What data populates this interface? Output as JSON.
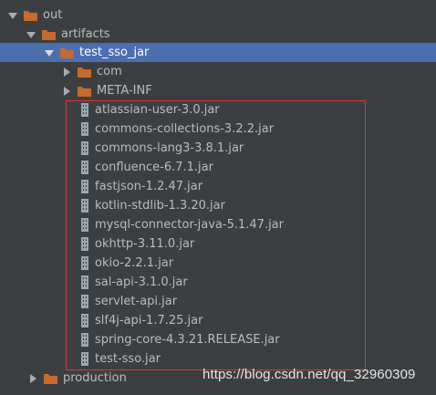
{
  "tree": {
    "out": {
      "label": "out"
    },
    "artifacts": {
      "label": "artifacts"
    },
    "test_sso_jar": {
      "label": "test_sso_jar"
    },
    "com": {
      "label": "com"
    },
    "meta_inf": {
      "label": "META-INF"
    },
    "jars": [
      {
        "label": "atlassian-user-3.0.jar"
      },
      {
        "label": "commons-collections-3.2.2.jar"
      },
      {
        "label": "commons-lang3-3.8.1.jar"
      },
      {
        "label": "confluence-6.7.1.jar"
      },
      {
        "label": "fastjson-1.2.47.jar"
      },
      {
        "label": "kotlin-stdlib-1.3.20.jar"
      },
      {
        "label": "mysql-connector-java-5.1.47.jar"
      },
      {
        "label": "okhttp-3.11.0.jar"
      },
      {
        "label": "okio-2.2.1.jar"
      },
      {
        "label": "sal-api-3.1.0.jar"
      },
      {
        "label": "servlet-api.jar"
      },
      {
        "label": "slf4j-api-1.7.25.jar"
      },
      {
        "label": "spring-core-4.3.21.RELEASE.jar"
      },
      {
        "label": "test-sso.jar"
      }
    ],
    "production": {
      "label": "production"
    }
  },
  "watermark": "https://blog.csdn.net/qq_32960309",
  "colors": {
    "background": "#3c3f41",
    "selection": "#4b6eaf",
    "folder": "#c8692d",
    "highlight_box": "#e0343a",
    "text": "#bbbbbb"
  }
}
